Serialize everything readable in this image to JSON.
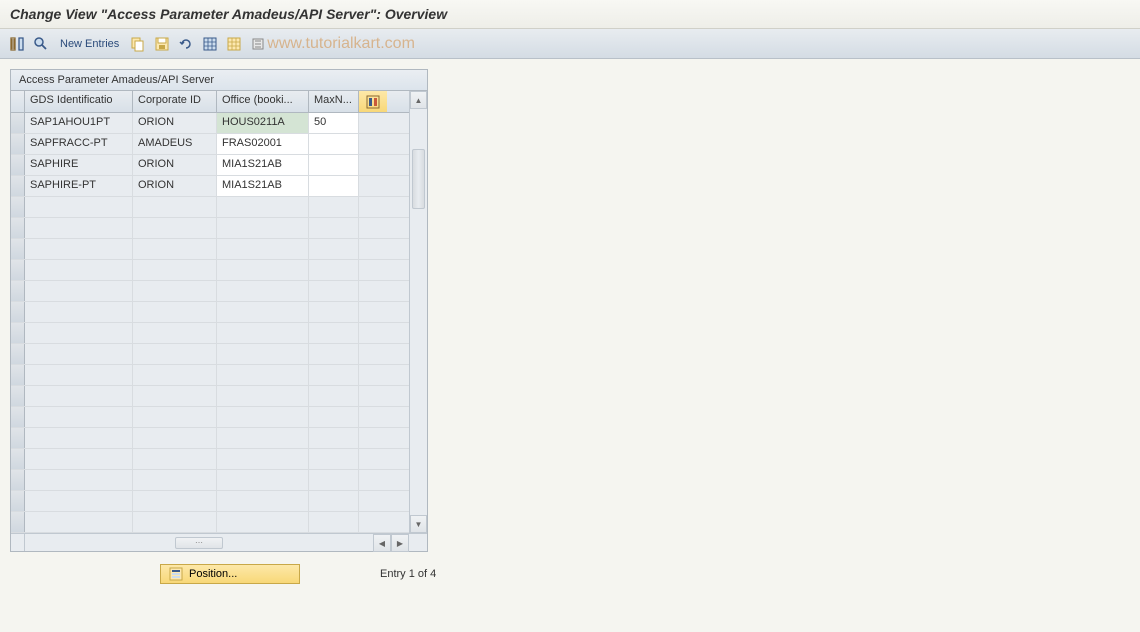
{
  "title": "Change View \"Access Parameter Amadeus/API Server\": Overview",
  "toolbar": {
    "new_entries": "New Entries"
  },
  "watermark": "www.tutorialkart.com",
  "table": {
    "title": "Access Parameter Amadeus/API Server",
    "columns": {
      "gds": "GDS Identificatio",
      "corp": "Corporate ID",
      "office": "Office (booki...",
      "maxn": "MaxN..."
    },
    "rows": [
      {
        "gds": "SAP1AHOU1PT",
        "corp": "ORION",
        "office": "HOUS0211A",
        "maxn": "50"
      },
      {
        "gds": "SAPFRACC-PT",
        "corp": "AMADEUS",
        "office": "FRAS02001",
        "maxn": ""
      },
      {
        "gds": "SAPHIRE",
        "corp": "ORION",
        "office": "MIA1S21AB",
        "maxn": ""
      },
      {
        "gds": "SAPHIRE-PT",
        "corp": "ORION",
        "office": "MIA1S21AB",
        "maxn": ""
      }
    ]
  },
  "footer": {
    "position_label": "Position...",
    "entry_text": "Entry 1 of 4"
  }
}
